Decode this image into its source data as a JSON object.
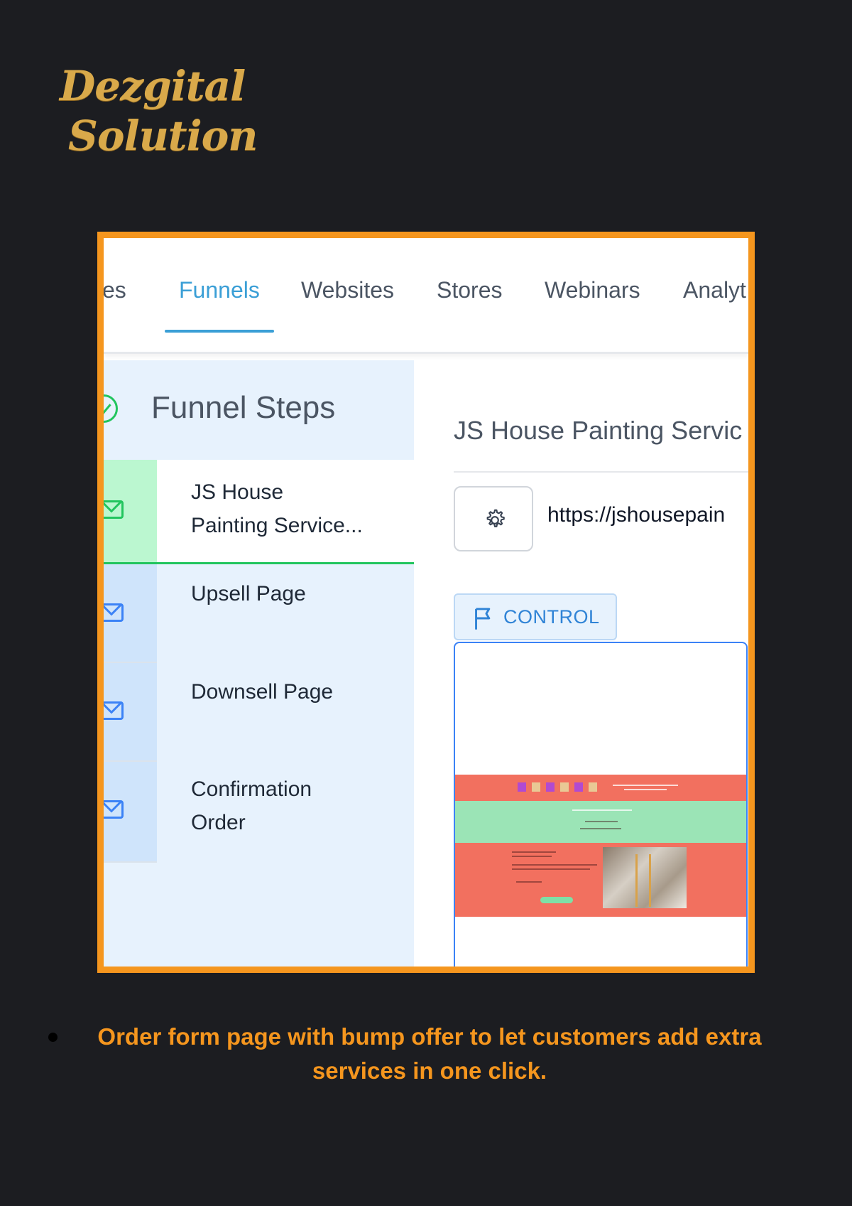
{
  "brand": {
    "line1": "Dezgital",
    "line2": "Solution",
    "color": "#d9a94a"
  },
  "nav": {
    "tabs": [
      {
        "label": "es",
        "active": false
      },
      {
        "label": "Funnels",
        "active": true
      },
      {
        "label": "Websites",
        "active": false
      },
      {
        "label": "Stores",
        "active": false
      },
      {
        "label": "Webinars",
        "active": false
      },
      {
        "label": "Analyt",
        "active": false
      }
    ]
  },
  "funnel": {
    "header": "Funnel Steps",
    "steps": [
      {
        "line1": "JS House",
        "line2": "Painting Service...",
        "selected": true
      },
      {
        "line1": "Upsell Page",
        "line2": "",
        "selected": false
      },
      {
        "line1": "Downsell Page",
        "line2": "",
        "selected": false
      },
      {
        "line1": "Confirmation",
        "line2": "Order",
        "selected": false
      }
    ]
  },
  "detail": {
    "title": "JS House Painting Servic",
    "settings_icon": "gear-icon",
    "url": "https://jshousepain",
    "control_label": "CONTROL",
    "control_icon": "flag-icon"
  },
  "caption": "Order form page with bump offer to let customers add extra services in one click.",
  "colors": {
    "frame": "#f5961e",
    "accent": "#3b9fd6",
    "success": "#22c55e",
    "background": "#1c1d21"
  }
}
